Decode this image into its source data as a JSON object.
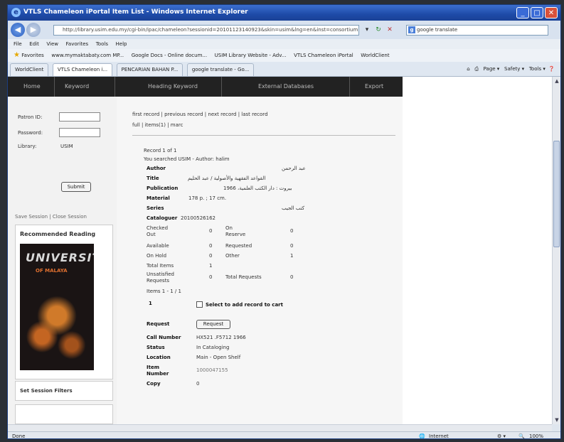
{
  "window": {
    "title": "VTLS Chameleon iPortal Item List - Windows Internet Explorer",
    "controls": [
      "_",
      "□",
      "✕"
    ]
  },
  "browser": {
    "address": "http://library.usim.edu.my/cgi-bin/ipac/chameleon?sessionid=20101123140923&skin=usim&lng=en&inst=consortium",
    "search_value": "google translate",
    "menu": [
      "File",
      "Edit",
      "View",
      "Favorites",
      "Tools",
      "Help"
    ],
    "favorites_label": "Favorites",
    "favorites": [
      "www.mymaktabaty.com MP...",
      "Google Docs - Online docum...",
      "USIM Library Website - Adv...",
      "VTLS Chameleon iPortal",
      "WorldClient"
    ],
    "tabs": [
      "WorldClient",
      "VTLS Chameleon i...",
      "PENCARIAN BAHAN P...",
      "google translate - Go..."
    ],
    "command_bar": [
      "Page ▾",
      "Safety ▾",
      "Tools ▾"
    ],
    "status_left": "Done",
    "status_zone": "Internet",
    "zoom": "100%"
  },
  "site_nav": [
    "Home",
    "Keyword",
    "Heading Keyword",
    "External Databases",
    "Export"
  ],
  "login": {
    "patron_label": "Patron ID:",
    "password_label": "Password:",
    "library_label": "Library:",
    "library_value": "USIM",
    "submit_label": "Submit",
    "session_links": "Save Session | Close Session"
  },
  "sidebar": {
    "recommended_title": "Recommended Reading",
    "book_title": "UNIVERSITY",
    "book_subtitle": "OF MALAYA",
    "filters_title": "Set Session Filters"
  },
  "record": {
    "nav_links": "first record | previous record | next record | last record",
    "view_links": "full | items(1) | marc",
    "record_count": "Record 1 of 1",
    "searched": "You searched USIM - Author: halim",
    "fields": {
      "author_label": "Author",
      "author_value": "عبد الرحمن",
      "title_label": "Title",
      "title_value": "القواعد الفقهية والأصولية / عبد الحليم",
      "publication_label": "Publication",
      "publication_value": "بيروت : دار الكتب العلمية، 1966",
      "material_label": "Material",
      "material_value": "178 p. ; 17 cm.",
      "series_label": "Series",
      "series_value": "كتب الجيب",
      "cataloguer_label": "Cataloguer",
      "cataloguer_value": "20100526162"
    },
    "stats": {
      "checked_out_label": "Checked Out",
      "checked_out": "0",
      "on_reserve_label": "On Reserve",
      "on_reserve": "0",
      "available_label": "Available",
      "available": "0",
      "requested_label": "Requested",
      "requested": "0",
      "on_hold_label": "On Hold",
      "on_hold": "0",
      "other_label": "Other",
      "other": "1",
      "total_items_label": "Total Items",
      "total_items": "1",
      "unsatisfied_label": "Unsatisfied Requests",
      "unsatisfied": "0",
      "total_requests_label": "Total Requests",
      "total_requests": "0"
    },
    "items_range": "Items 1 - 1 / 1",
    "item_index": "1",
    "select_label": "Select to add record to cart",
    "request_label": "Request",
    "request_button": "Request",
    "call_number_label": "Call Number",
    "call_number": "HX521 .F5712 1966",
    "status_label": "Status",
    "status": "In Cataloging",
    "location_label": "Location",
    "location": "Main - Open Shelf",
    "item_number_label": "Item Number",
    "item_number": "1000047155",
    "copy_label": "Copy",
    "copy": "0"
  }
}
